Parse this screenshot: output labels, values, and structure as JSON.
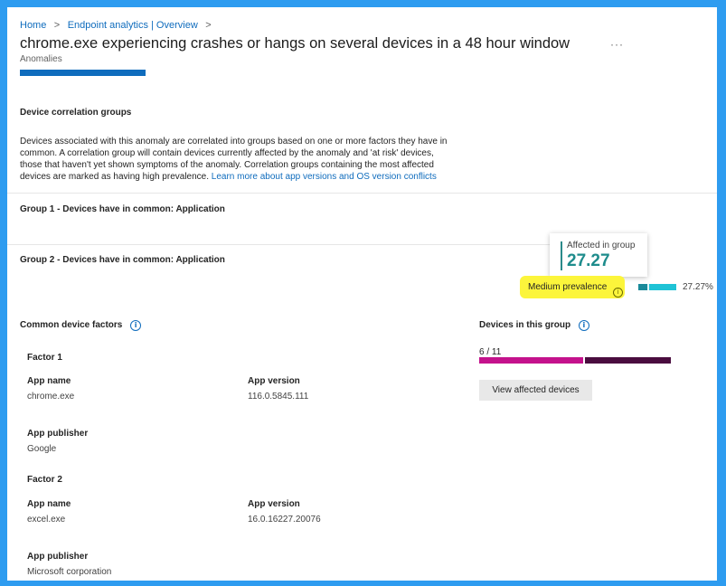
{
  "breadcrumb": {
    "items": [
      "Home",
      "Endpoint analytics | Overview"
    ],
    "separator": ">"
  },
  "header": {
    "title": "chrome.exe experiencing crashes or hangs on several devices in a 48 hour window",
    "subtitle": "Anomalies",
    "more_label": "···"
  },
  "correlation": {
    "heading": "Device correlation groups",
    "description": "Devices associated with this anomaly are correlated into groups based on one or more factors they have in common. A correlation group will contain devices currently affected by the anomaly and 'at risk' devices, those that haven't yet shown symptoms of the anomaly. Correlation groups containing the most affected devices are marked as having high prevalence.",
    "link": "Learn more about app versions and OS version conflicts"
  },
  "groups": [
    {
      "label": "Group 1 - Devices have in common: Application"
    },
    {
      "label": "Group 2 - Devices have in common: Application"
    }
  ],
  "tooltip": {
    "label": "Affected in group",
    "value": "27.27"
  },
  "prevalence": {
    "label": "Medium prevalence",
    "percent_text": "27.27%",
    "percent": 27.27,
    "bar_color": "#1fc3d6",
    "highlight_color": "#fcf53b"
  },
  "factors_section": {
    "heading": "Common device factors",
    "factors": [
      {
        "title": "Factor 1",
        "app_name_label": "App name",
        "app_name": "chrome.exe",
        "app_version_label": "App version",
        "app_version": "116.0.5845.111",
        "publisher_label": "App publisher",
        "publisher": "Google"
      },
      {
        "title": "Factor 2",
        "app_name_label": "App name",
        "app_name": "excel.exe",
        "app_version_label": "App version",
        "app_version": "16.0.16227.20076",
        "publisher_label": "App publisher",
        "publisher": "Microsoft corporation"
      }
    ]
  },
  "devices_section": {
    "heading": "Devices in this group",
    "count_text": "6 / 11",
    "affected": 6,
    "total": 11,
    "affected_color": "#c4128c",
    "at_risk_color": "#4a0d3f",
    "button_label": "View affected devices"
  },
  "colors": {
    "frame": "#2e9cf0",
    "link": "#0f6cbd",
    "progress": "#0f6cbd"
  }
}
